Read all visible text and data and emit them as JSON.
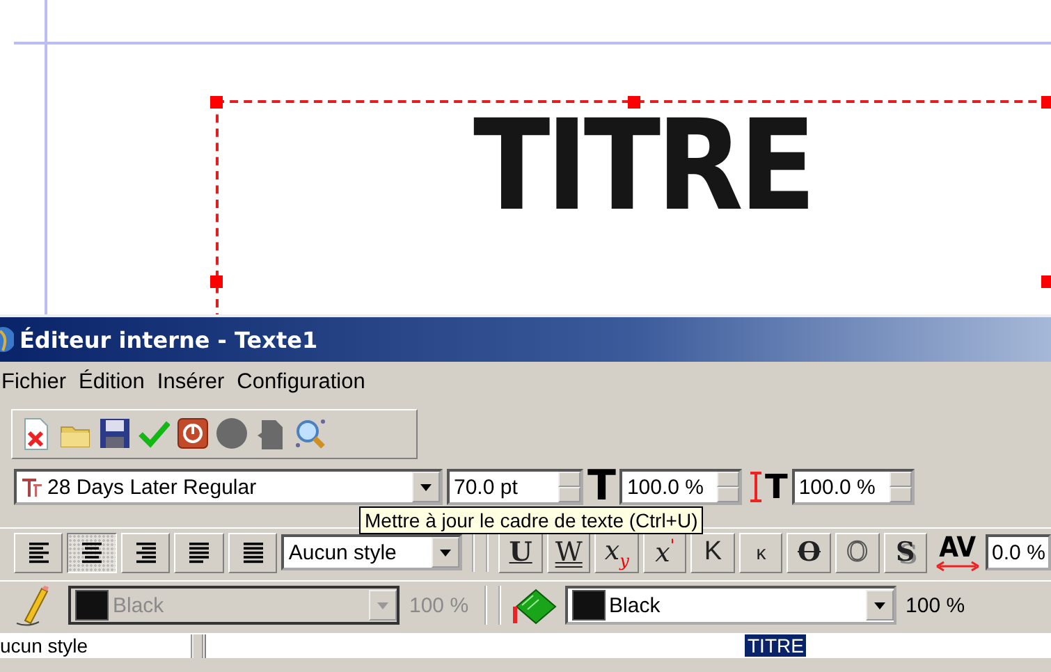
{
  "canvas": {
    "frame_text": "TITRE",
    "frame_selected": true
  },
  "window": {
    "title": "Éditeur interne - Texte1"
  },
  "menu": [
    "Fichier",
    "Édition",
    "Insérer",
    "Configuration"
  ],
  "font_row": {
    "family": "28 Days Later Regular",
    "size": "70.0 pt",
    "width_glyph": "T",
    "width_scale": "100.0 %",
    "height_glyph": "T",
    "height_scale": "100.0 %"
  },
  "tooltip": "Mettre à jour le cadre de texte (Ctrl+U)",
  "alignment": [
    {
      "kind": "left",
      "selected": false
    },
    {
      "kind": "center",
      "selected": true
    },
    {
      "kind": "right",
      "selected": false
    },
    {
      "kind": "block",
      "selected": false
    },
    {
      "kind": "forced",
      "selected": false
    }
  ],
  "paragraph_style": "Aucun style",
  "effects": [
    {
      "kind": "underline",
      "glyph": "U"
    },
    {
      "kind": "word-underline",
      "glyph": "W"
    },
    {
      "kind": "subscript",
      "glyph": "x$_{y}$"
    },
    {
      "kind": "superscript",
      "glyph": "x$^{'}$"
    },
    {
      "kind": "caps",
      "glyph": "K"
    },
    {
      "kind": "small-caps",
      "glyph": "κ"
    },
    {
      "kind": "strike",
      "glyph": "O"
    },
    {
      "kind": "outline",
      "glyph": "O"
    },
    {
      "kind": "shadow",
      "glyph": "S"
    }
  ],
  "tracking": {
    "glyph": "AV",
    "value": "0.0 %"
  },
  "stroke": {
    "color_name": "Black",
    "color": "#111111",
    "shade": "100 %",
    "disabled": true
  },
  "fill": {
    "color_name": "Black",
    "color": "#111111",
    "shade": "100 %",
    "disabled": false
  },
  "style_list": {
    "item": "ucun style"
  },
  "text_area": {
    "text": "TITRE",
    "selected": true
  }
}
